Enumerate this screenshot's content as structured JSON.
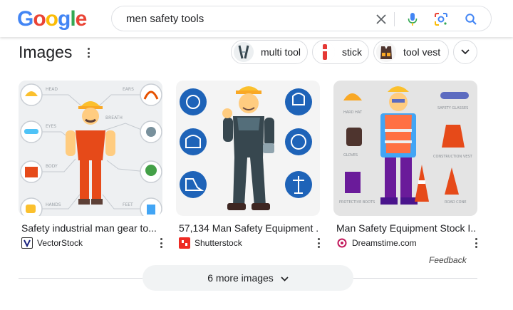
{
  "search": {
    "query": "men safety tools"
  },
  "section": {
    "title": "Images"
  },
  "chips": [
    {
      "label": "multi tool",
      "icon": "multi-tool-thumb"
    },
    {
      "label": "stick",
      "icon": "stick-thumb"
    },
    {
      "label": "tool vest",
      "icon": "tool-vest-thumb"
    }
  ],
  "results": [
    {
      "title": "Safety industrial man gear to...",
      "source": "VectorStock",
      "labels": [
        "HEAD",
        "EARS",
        "EYES",
        "BREATH",
        "BODY",
        "HANDS",
        "FEET"
      ]
    },
    {
      "title": "57,134 Man Safety Equipment ...",
      "source": "Shutterstock"
    },
    {
      "title": "Man Safety Equipment Stock I...",
      "source": "Dreamstime.com",
      "labels": [
        "HARD HAT",
        "SAFETY GLASSES",
        "GLOVES",
        "CONSTRUCTION VEST",
        "PROTECTIVE BOOTS",
        "ROAD CONE"
      ]
    }
  ],
  "feedback": "Feedback",
  "more_images": "6 more images",
  "colors": {
    "google_blue": "#4285F4",
    "google_red": "#EA4335",
    "google_yellow": "#FBBC05",
    "google_green": "#34A853"
  }
}
